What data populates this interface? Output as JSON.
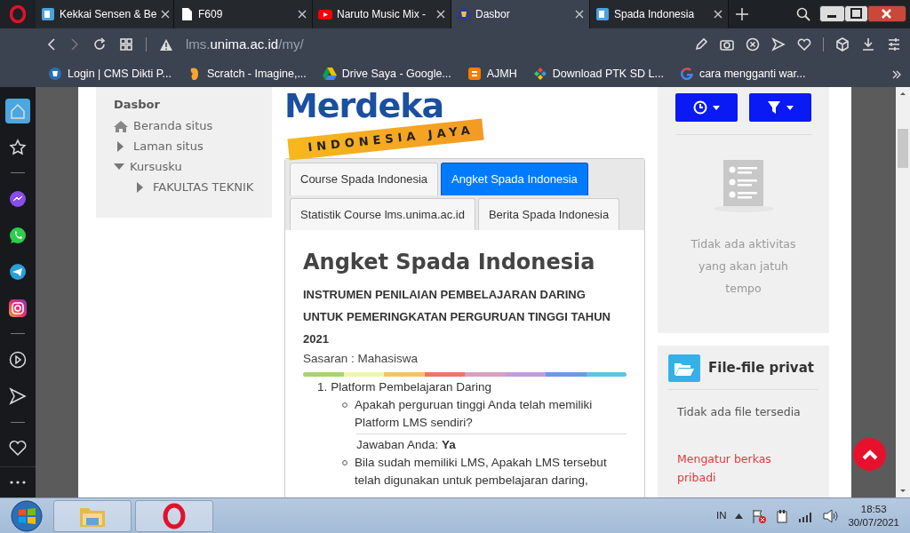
{
  "browser": {
    "tabs": [
      {
        "title": "Kekkai Sensen & Be",
        "kind": "site",
        "selected": false
      },
      {
        "title": "F609",
        "kind": "doc",
        "selected": false
      },
      {
        "title": "Naruto Music Mix -",
        "kind": "video",
        "selected": false
      },
      {
        "title": "Dasbor",
        "kind": "crest",
        "selected": true
      },
      {
        "title": "Spada Indonesia",
        "kind": "site",
        "selected": false
      }
    ],
    "address": {
      "prefix": "lms.",
      "host": "unima.ac.id",
      "path": "/my/"
    },
    "bookmarks": [
      {
        "title": "Login | CMS Dikti P...",
        "kind": "crest"
      },
      {
        "title": "Scratch - Imagine,...",
        "kind": "scratch"
      },
      {
        "title": "Drive Saya - Google...",
        "kind": "drive"
      },
      {
        "title": "AJMH",
        "kind": "blogger"
      },
      {
        "title": "Download PTK SD L...",
        "kind": "diamond"
      },
      {
        "title": "cara mengganti war...",
        "kind": "google"
      }
    ]
  },
  "sidebar": [
    {
      "kind": "home",
      "selected": true
    },
    {
      "kind": "star",
      "selected": false
    },
    {
      "kind": "divider"
    },
    {
      "kind": "messenger",
      "selected": false
    },
    {
      "kind": "whatsapp",
      "selected": false
    },
    {
      "kind": "telegram",
      "selected": false
    },
    {
      "kind": "instagram",
      "selected": false
    },
    {
      "kind": "divider"
    },
    {
      "kind": "player",
      "selected": false
    },
    {
      "kind": "send",
      "selected": false
    },
    {
      "kind": "divider"
    },
    {
      "kind": "heart",
      "selected": false
    }
  ],
  "navigation": {
    "title": "Dasbor",
    "items": [
      {
        "label": "Beranda situs",
        "kind": "home"
      },
      {
        "label": "Laman situs",
        "kind": "branch",
        "expanded": false
      },
      {
        "label": "Kursusku",
        "kind": "branch",
        "expanded": true,
        "children": [
          {
            "label": "FAKULTAS TEKNIK",
            "kind": "branch",
            "expanded": false
          }
        ]
      }
    ]
  },
  "logo": {
    "word": "Merdeka",
    "ribbon": "INDONESIA JAYA"
  },
  "tabs": [
    {
      "label": "Course Spada Indonesia",
      "selected": false
    },
    {
      "label": "Angket Spada Indonesia",
      "selected": true
    },
    {
      "label": "Statistik Course lms.unima.ac.id",
      "selected": false
    },
    {
      "label": "Berita Spada Indonesia",
      "selected": false
    }
  ],
  "article": {
    "title": "Angket Spada Indonesia",
    "subtitle": "INSTRUMEN PENILAIAN PEMBELAJARAN DARING UNTUK PEMERINGKATAN PERGURUAN TINGGI TAHUN 2021",
    "target": "Sasaran : Mahasiswa",
    "stripes": [
      {
        "color": "#a8d46f"
      },
      {
        "color": "#eef5b0"
      },
      {
        "color": "#f5c26b"
      },
      {
        "color": "#e9766a"
      },
      {
        "color": "#d9a0c0"
      },
      {
        "color": "#c49be0"
      },
      {
        "color": "#6a9be0"
      },
      {
        "color": "#62c1e5"
      }
    ],
    "sections": [
      {
        "number": "1.",
        "title": "Platform Pembelajaran Daring",
        "questions": [
          {
            "text": "Apakah perguruan tinggi Anda telah memiliki Platform LMS sendiri?",
            "answer_label": "Jawaban Anda:",
            "answer": "Ya"
          },
          {
            "text": "Bila sudah memiliki LMS, Apakah LMS tersebut telah digunakan untuk pembelajaran daring,"
          }
        ]
      }
    ]
  },
  "timeline": {
    "empty_text": "Tidak ada aktivitas yang akan jatuh tempo"
  },
  "private_files": {
    "title": "File-file privat",
    "empty_text": "Tidak ada file tersedia",
    "link": "Mengatur berkas pribadi"
  },
  "taskbar": {
    "language": "IN",
    "time": "18:53",
    "date": "30/07/2021"
  }
}
